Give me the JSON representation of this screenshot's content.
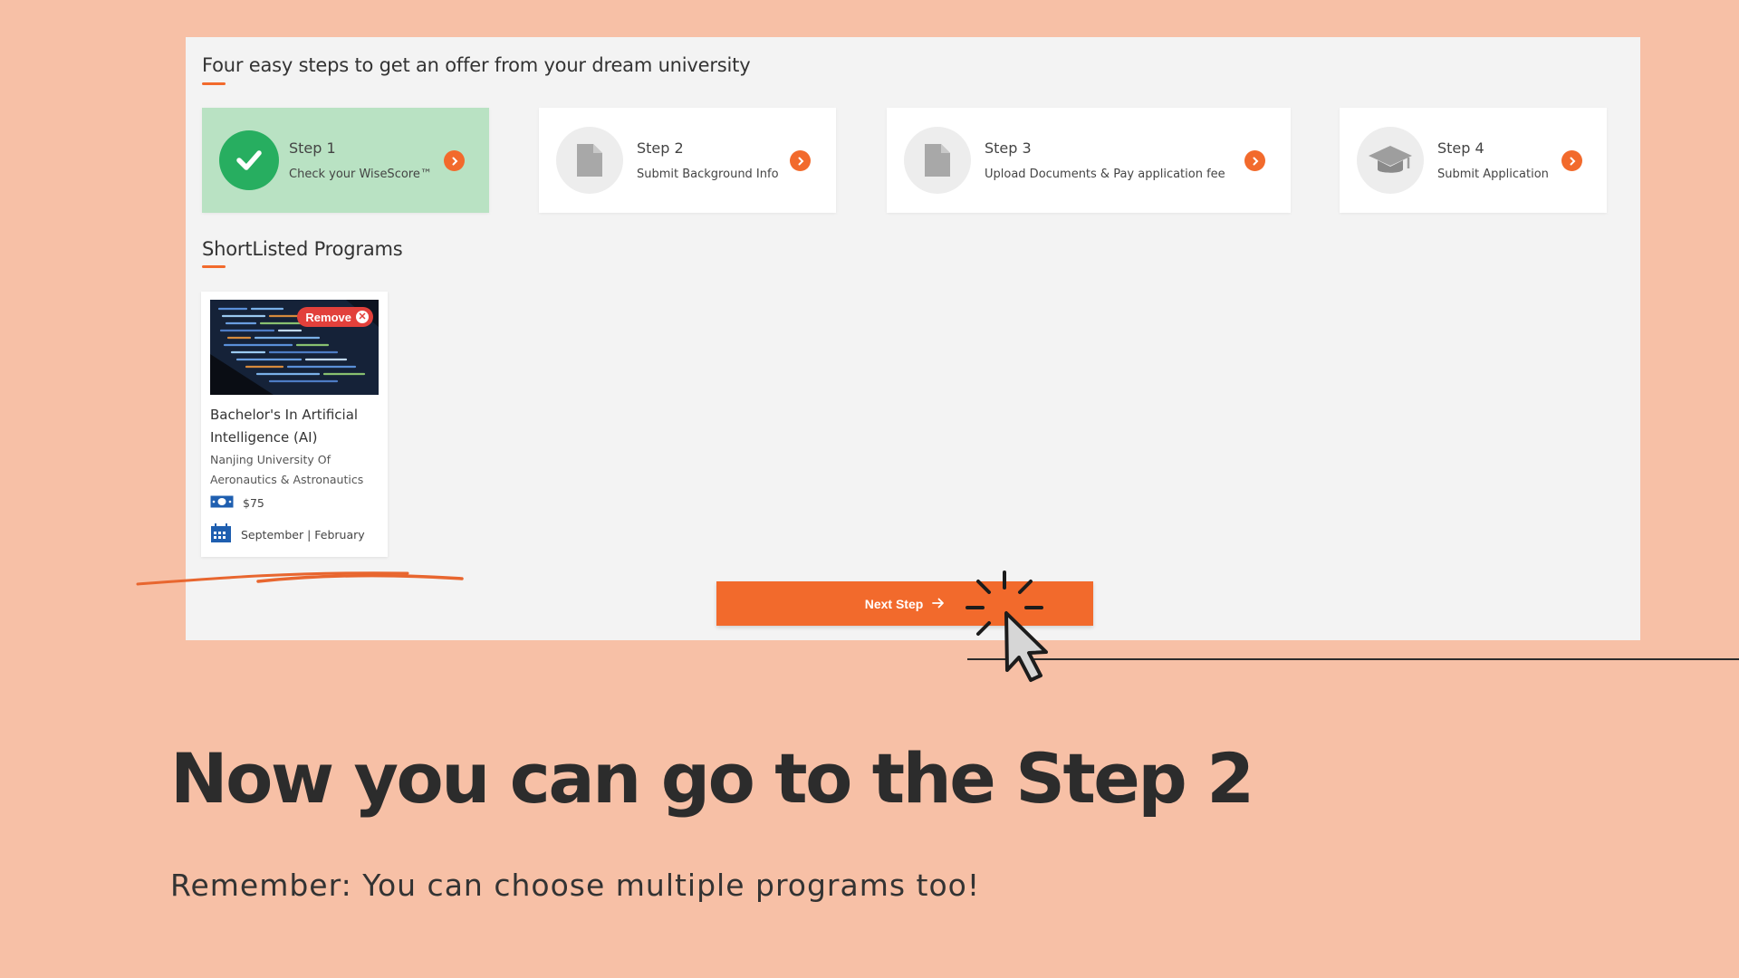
{
  "steps_section": {
    "title": "Four easy steps to get an offer from your dream university"
  },
  "steps": [
    {
      "num": "Step 1",
      "desc": "Check your WiseScore™",
      "status": "completed",
      "icon": "check-icon"
    },
    {
      "num": "Step 2",
      "desc": "Submit Background Info",
      "status": "pending",
      "icon": "document-icon"
    },
    {
      "num": "Step 3",
      "desc": "Upload Documents & Pay application fee",
      "status": "pending",
      "icon": "document-icon"
    },
    {
      "num": "Step 4",
      "desc": "Submit Application",
      "status": "pending",
      "icon": "graduation-cap-icon"
    }
  ],
  "shortlist": {
    "title": "ShortListed Programs",
    "programs": [
      {
        "remove_label": "Remove",
        "title": "Bachelor's In Artificial Intelligence (AI)",
        "university": "Nanjing University Of Aeronautics & Astronautics",
        "fee": "$75",
        "intake": "September | February"
      }
    ]
  },
  "next_button": {
    "label": "Next Step"
  },
  "slide": {
    "headline": "Now you can go to the Step 2",
    "subline": "Remember: You can choose multiple programs too!"
  },
  "colors": {
    "background": "#f7c0a6",
    "accent": "#f26a2c",
    "done_green": "#27ae60",
    "done_card": "#b9e2c3",
    "remove_red": "#e2403b"
  }
}
